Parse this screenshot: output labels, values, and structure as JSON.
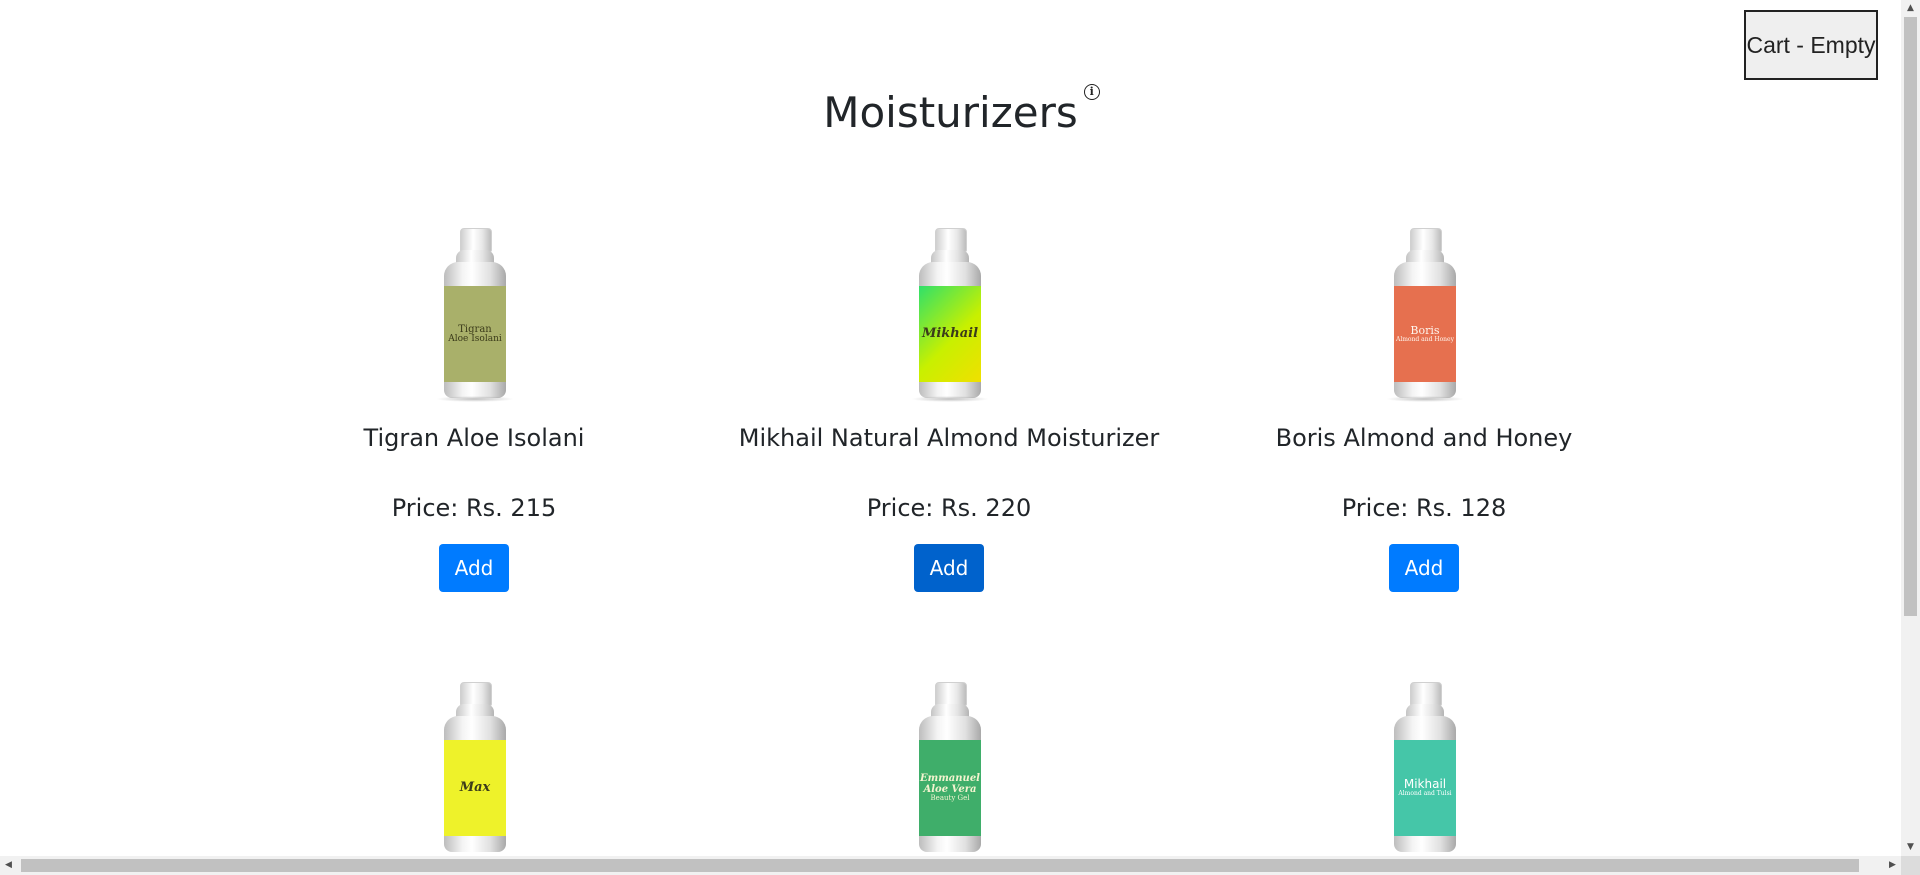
{
  "cart": {
    "label": "Cart - Empty"
  },
  "page": {
    "title": "Moisturizers",
    "info_icon": "info-icon"
  },
  "products": [
    {
      "name": "Tigran Aloe Isolani",
      "price": "Price: Rs. 215",
      "add_label": "Add",
      "label_brand": "Tigran",
      "label_sub": "Aloe Isolani",
      "label_color": "#a9b06a"
    },
    {
      "name": "Mikhail Natural Almond Moisturizer",
      "price": "Price: Rs. 220",
      "add_label": "Add",
      "label_brand": "Mikhail",
      "label_sub": "",
      "label_color": "#a6e22e"
    },
    {
      "name": "Boris Almond and Honey",
      "price": "Price: Rs. 128",
      "add_label": "Add",
      "label_brand": "Boris",
      "label_sub": "Almond and Honey",
      "label_color": "#e6704f"
    },
    {
      "name": "",
      "price": "",
      "add_label": "",
      "label_brand": "Max",
      "label_sub": "",
      "label_color": "#eef22a"
    },
    {
      "name": "",
      "price": "",
      "add_label": "",
      "label_brand": "Emmanuel Aloe Vera",
      "label_sub": "Beauty Gel",
      "label_color": "#3fae6a"
    },
    {
      "name": "",
      "price": "",
      "add_label": "",
      "label_brand": "Mikhail",
      "label_sub": "Almond and Tulsi",
      "label_color": "#45c6a8"
    }
  ],
  "colors": {
    "primary": "#007bff",
    "primary_focused": "#0062cc",
    "text": "#212529"
  }
}
